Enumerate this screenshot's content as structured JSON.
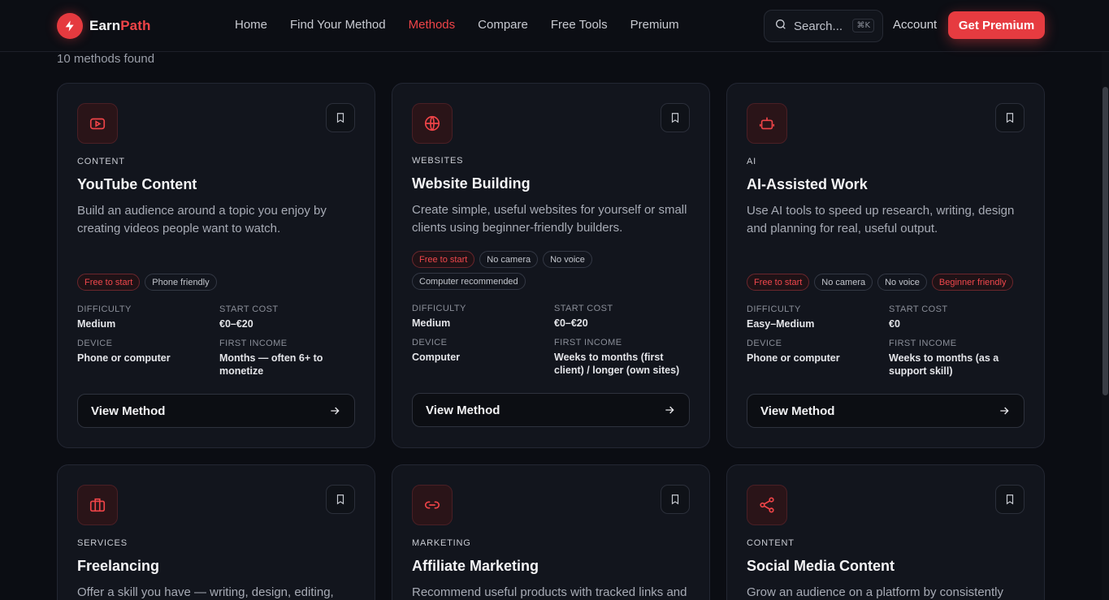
{
  "header": {
    "logo_part1": "Earn",
    "logo_part2": "Path",
    "nav": [
      "Home",
      "Find Your Method",
      "Methods",
      "Compare",
      "Free Tools",
      "Premium"
    ],
    "active_nav": "Methods",
    "search_placeholder": "Search...",
    "search_shortcut": "⌘K",
    "account": "Account",
    "cta": "Get Premium"
  },
  "results_count": "10 methods found",
  "labels": {
    "difficulty": "DIFFICULTY",
    "start_cost": "START COST",
    "device": "DEVICE",
    "first_income": "FIRST INCOME",
    "view": "View Method"
  },
  "cards": [
    {
      "icon": "youtube-icon",
      "category": "CONTENT",
      "title": "YouTube Content",
      "description": "Build an audience around a topic you enjoy by creating videos people want to watch.",
      "tags": [
        {
          "text": "Free to start",
          "accent": true
        },
        {
          "text": "Phone friendly",
          "accent": false
        }
      ],
      "difficulty": "Medium",
      "start_cost": "€0–€20",
      "device": "Phone or computer",
      "first_income": "Months — often 6+ to monetize"
    },
    {
      "icon": "globe-icon",
      "category": "WEBSITES",
      "title": "Website Building",
      "description": "Create simple, useful websites for yourself or small clients using beginner-friendly builders.",
      "tags": [
        {
          "text": "Free to start",
          "accent": true
        },
        {
          "text": "No camera",
          "accent": false
        },
        {
          "text": "No voice",
          "accent": false
        },
        {
          "text": "Computer recommended",
          "accent": false
        }
      ],
      "difficulty": "Medium",
      "start_cost": "€0–€20",
      "device": "Computer",
      "first_income": "Weeks to months (first client) / longer (own sites)"
    },
    {
      "icon": "robot-icon",
      "category": "AI",
      "title": "AI-Assisted Work",
      "description": "Use AI tools to speed up research, writing, design and planning for real, useful output.",
      "tags": [
        {
          "text": "Free to start",
          "accent": true
        },
        {
          "text": "No camera",
          "accent": false
        },
        {
          "text": "No voice",
          "accent": false
        },
        {
          "text": "Beginner friendly",
          "accent": true
        }
      ],
      "difficulty": "Easy–Medium",
      "start_cost": "€0",
      "device": "Phone or computer",
      "first_income": "Weeks to months (as a support skill)"
    },
    {
      "icon": "briefcase-icon",
      "category": "SERVICES",
      "title": "Freelancing",
      "description": "Offer a skill you have — writing, design, editing,"
    },
    {
      "icon": "link-icon",
      "category": "MARKETING",
      "title": "Affiliate Marketing",
      "description": "Recommend useful products with tracked links and"
    },
    {
      "icon": "share-icon",
      "category": "CONTENT",
      "title": "Social Media Content",
      "description": "Grow an audience on a platform by consistently"
    }
  ]
}
